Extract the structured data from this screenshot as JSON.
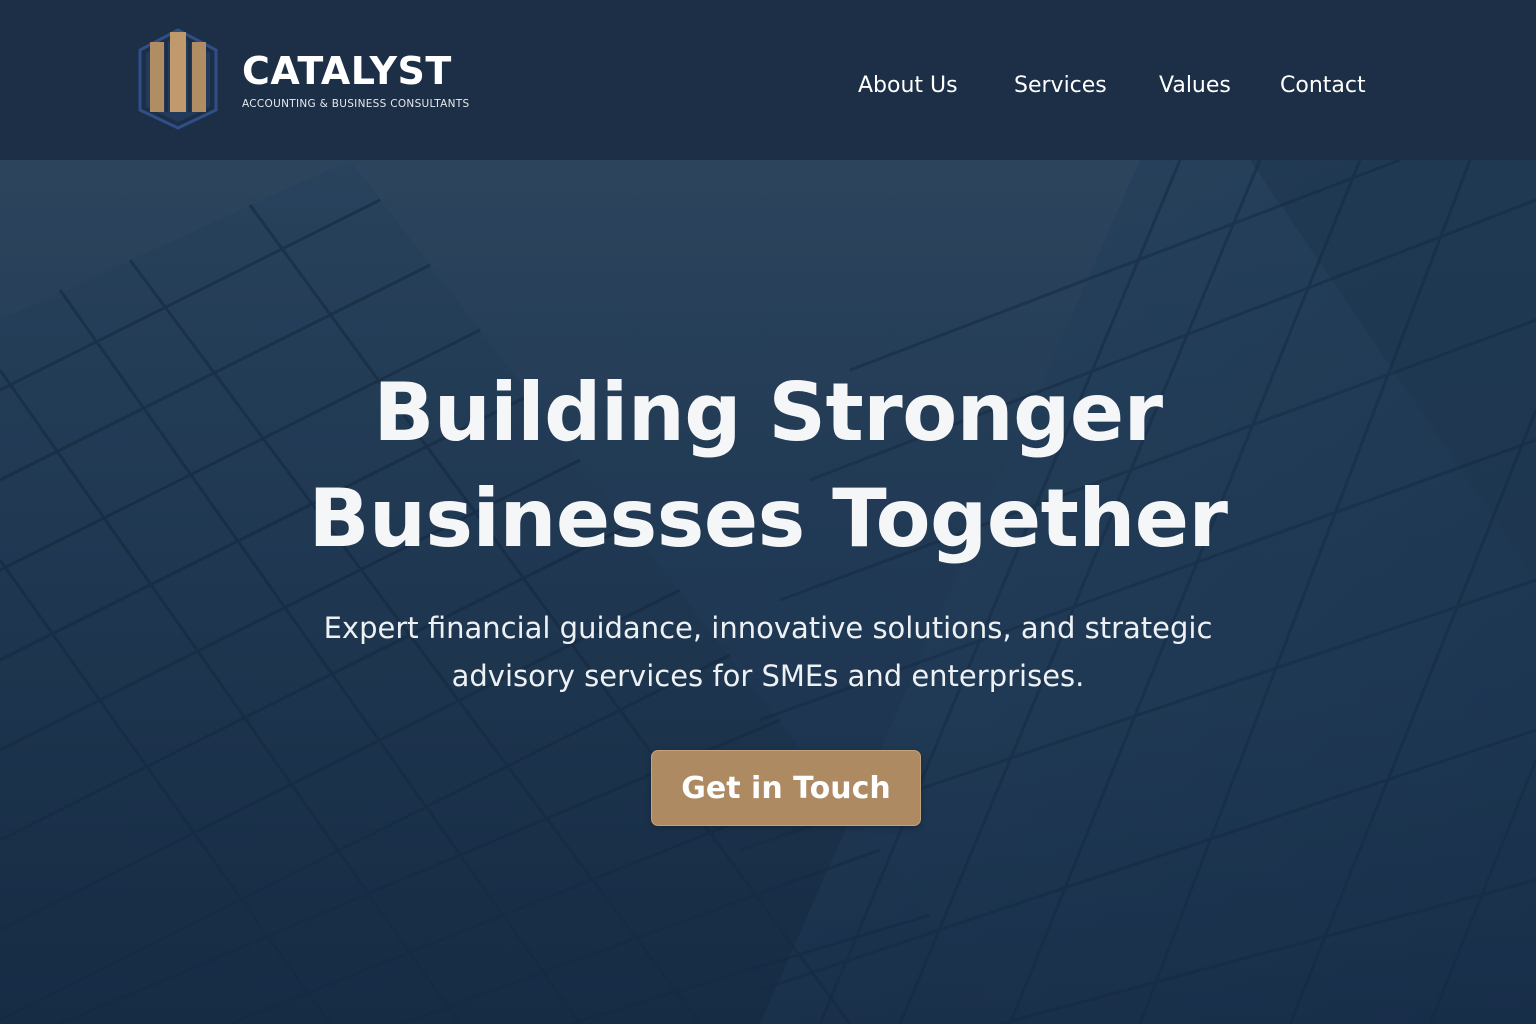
{
  "brand": {
    "name": "CATALYST",
    "tagline": "ACCOUNTING & BUSINESS CONSULTANTS",
    "logo_icon": "building-columns-icon"
  },
  "nav": {
    "items": [
      {
        "label": "About Us"
      },
      {
        "label": "Services"
      },
      {
        "label": "Values"
      },
      {
        "label": "Contact"
      }
    ]
  },
  "hero": {
    "title_line1": "Building Stronger",
    "title_line2": "Businesses Together",
    "subtitle_line1": "Expert financial guidance, innovative solutions, and strategic",
    "subtitle_line2": "advisory services for SMEs and enterprises.",
    "cta_label": "Get in Touch",
    "background": "glass-building-facade-image"
  },
  "colors": {
    "header_bg": "#1c2f46",
    "hero_bg": "#233d57",
    "accent_gold": "#ad8a61",
    "text_white": "#ffffff"
  }
}
